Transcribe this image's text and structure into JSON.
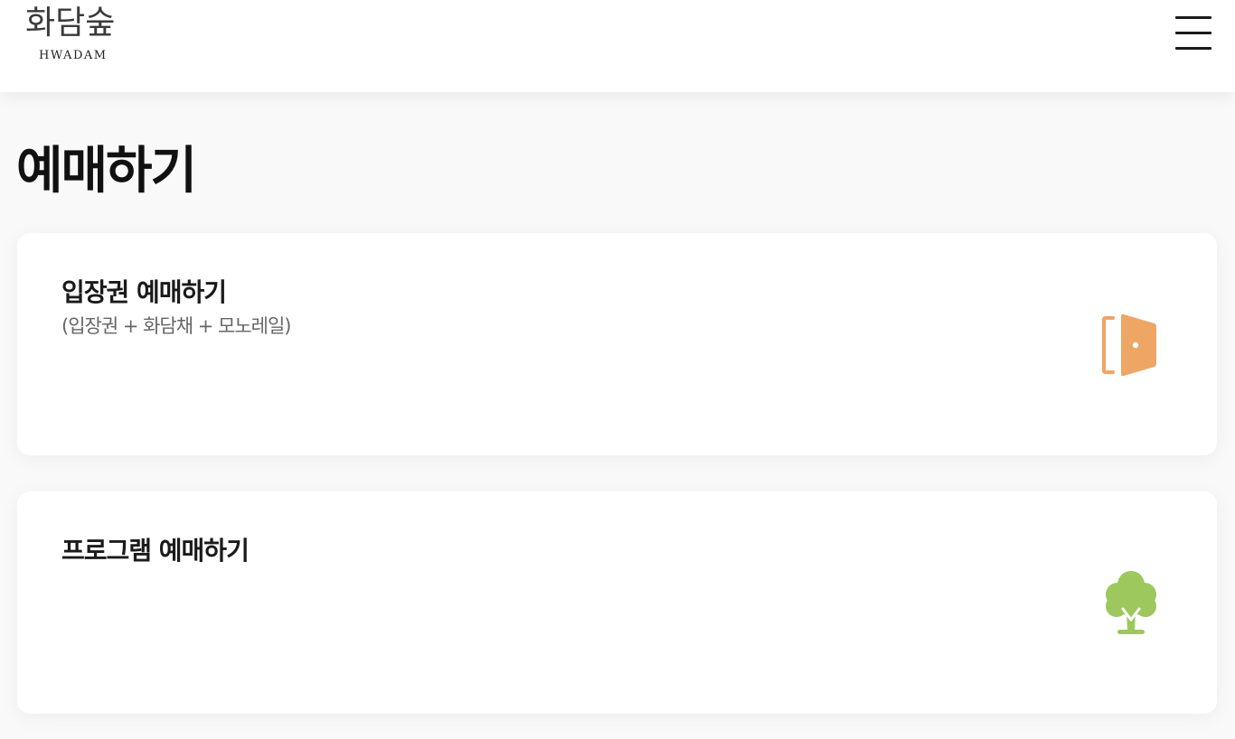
{
  "header": {
    "logo_korean": "화담숲",
    "logo_english": "HWADAM",
    "menu_icon": "hamburger-menu-icon"
  },
  "page": {
    "title": "예매하기"
  },
  "cards": [
    {
      "title": "입장권 예매하기",
      "subtitle": "(입장권 + 화담채 + 모노레일)",
      "icon": "door-icon",
      "icon_color": "#eea664"
    },
    {
      "title": "프로그램 예매하기",
      "icon": "tree-icon",
      "icon_color": "#9cc85e"
    }
  ]
}
